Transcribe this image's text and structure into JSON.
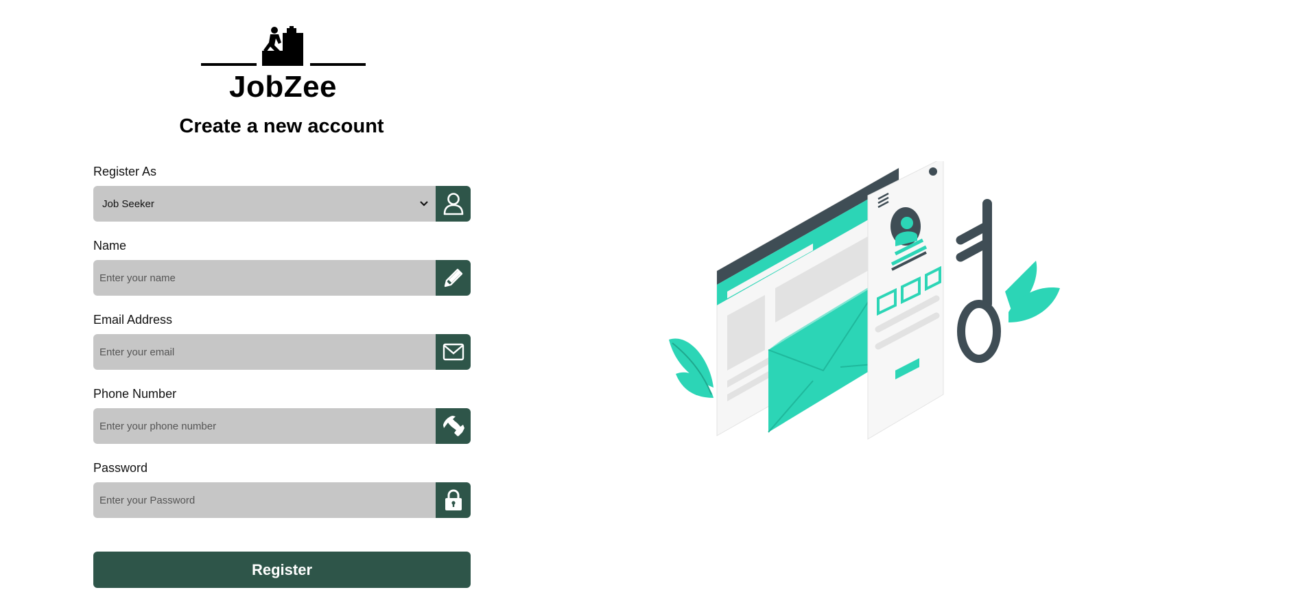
{
  "brand": {
    "name": "JobZee"
  },
  "page": {
    "title": "Create a new account"
  },
  "form": {
    "register_as": {
      "label": "Register As",
      "value": "Job Seeker",
      "icon": "user-icon"
    },
    "name": {
      "label": "Name",
      "placeholder": "Enter your name",
      "icon": "pencil-icon"
    },
    "email": {
      "label": "Email Address",
      "placeholder": "Enter your email",
      "icon": "envelope-icon"
    },
    "phone": {
      "label": "Phone Number",
      "placeholder": "Enter your phone number",
      "icon": "phone-icon"
    },
    "password": {
      "label": "Password",
      "placeholder": "Enter your Password",
      "icon": "lock-icon"
    },
    "submit_label": "Register"
  },
  "colors": {
    "accent": "#2e5549",
    "input_bg": "#c6c6c6",
    "illustration_teal": "#2cd5b6",
    "illustration_dark": "#3f4d55"
  }
}
